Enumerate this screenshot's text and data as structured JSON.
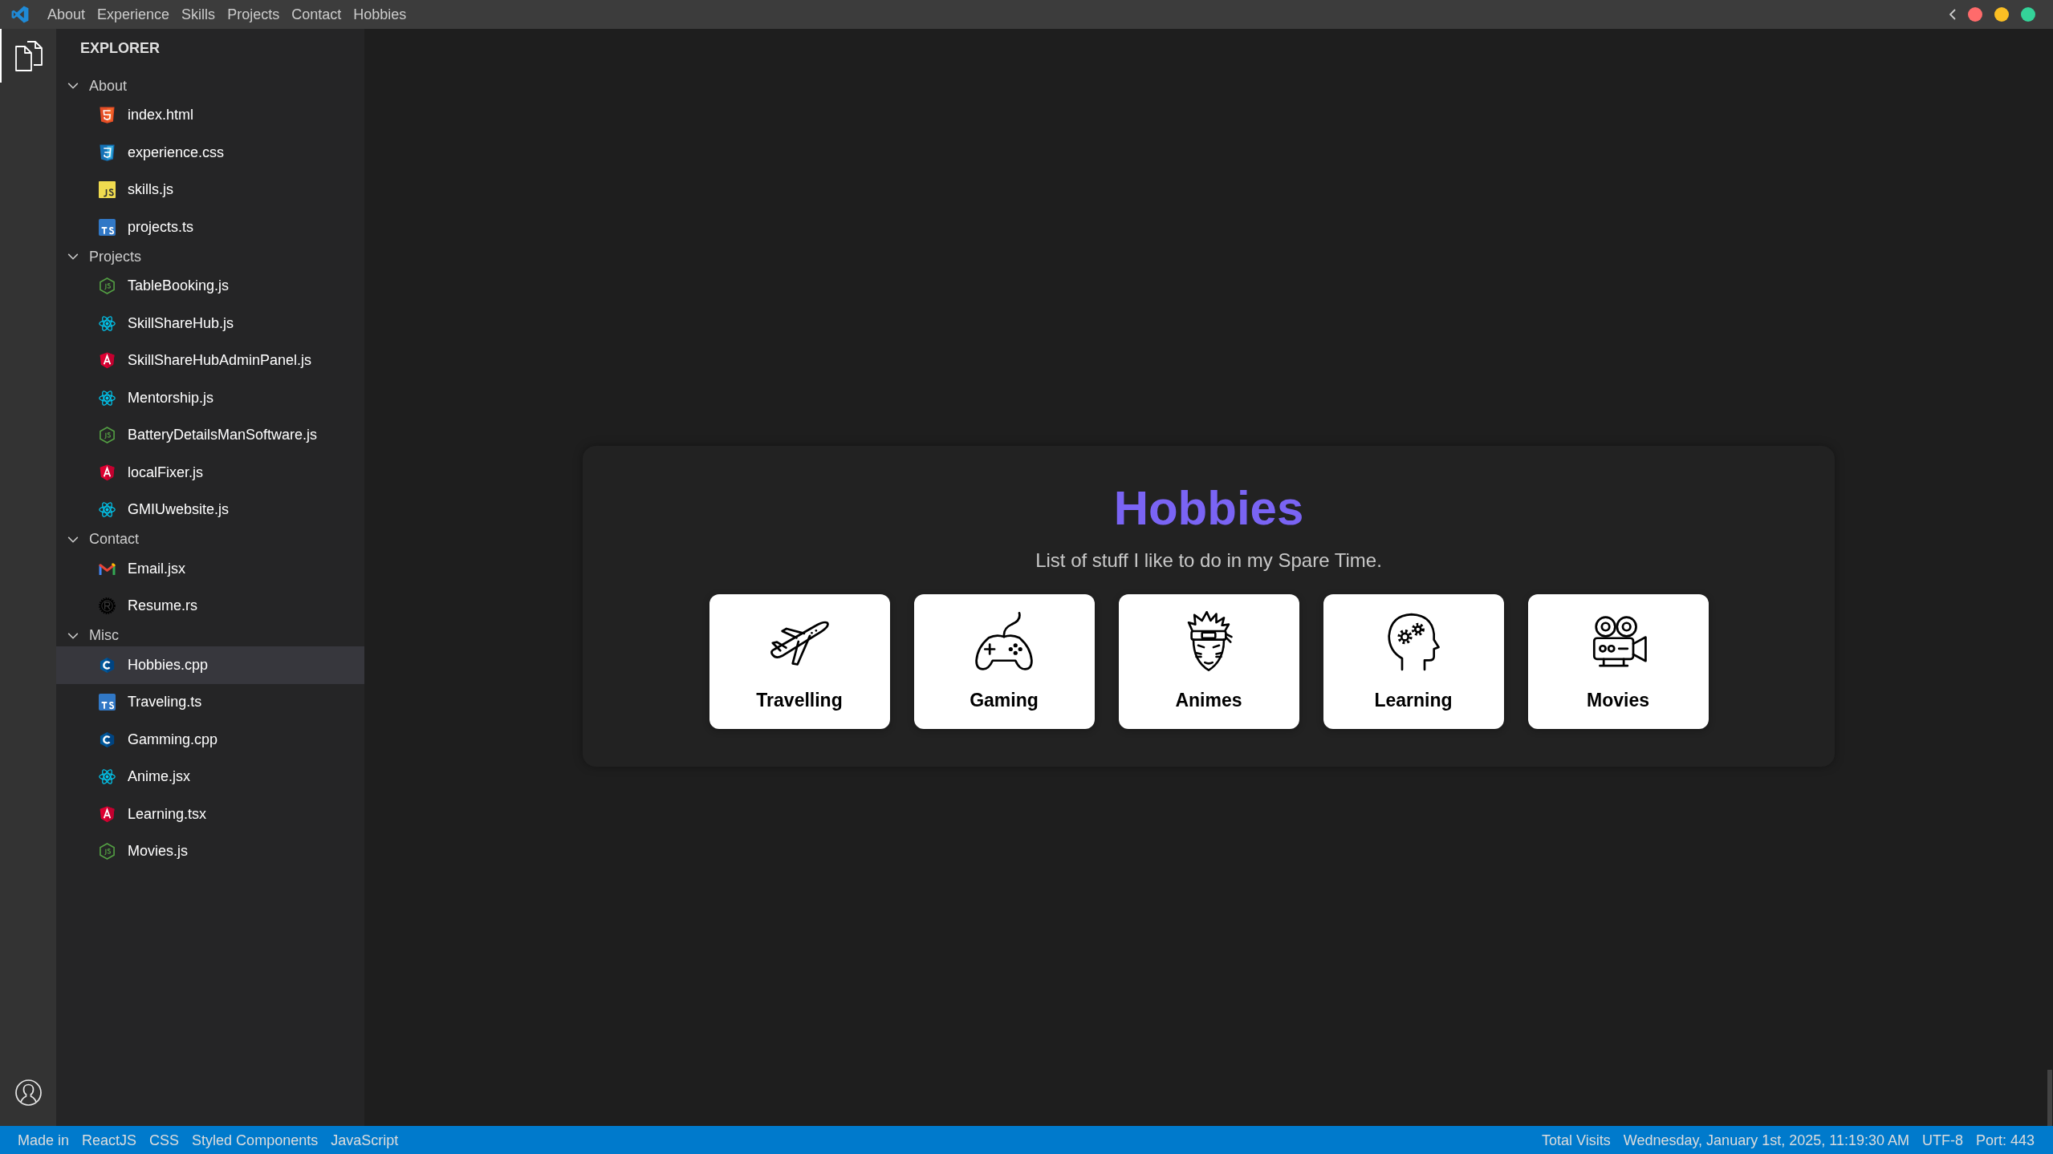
{
  "title_bar": {
    "menu": [
      "About",
      "Experience",
      "Skills",
      "Projects",
      "Contact",
      "Hobbies"
    ],
    "window_controls": [
      {
        "color": "#ff6b6b"
      },
      {
        "color": "#fbbf24"
      },
      {
        "color": "#34d399"
      }
    ]
  },
  "activity_bar": {
    "items": [
      {
        "selected": true
      }
    ]
  },
  "explorer": {
    "title": "EXPLORER",
    "folders": [
      {
        "label": "About",
        "expanded": true,
        "children": [
          {
            "label": "index.html",
            "kind": "html",
            "selected": false
          },
          {
            "label": "experience.css",
            "kind": "css",
            "selected": false
          },
          {
            "label": "skills.js",
            "kind": "js",
            "selected": false
          },
          {
            "label": "projects.ts",
            "kind": "ts",
            "selected": false
          }
        ]
      },
      {
        "label": "Projects",
        "expanded": true,
        "children": [
          {
            "label": "TableBooking.js",
            "kind": "node",
            "selected": false
          },
          {
            "label": "SkillShareHub.js",
            "kind": "react",
            "selected": false
          },
          {
            "label": "SkillShareHubAdminPanel.js",
            "kind": "angular",
            "selected": false
          },
          {
            "label": "Mentorship.js",
            "kind": "react",
            "selected": false
          },
          {
            "label": "BatteryDetailsManSoftware.js",
            "kind": "node",
            "selected": false
          },
          {
            "label": "localFixer.js",
            "kind": "angular",
            "selected": false
          },
          {
            "label": "GMIUwebsite.js",
            "kind": "react",
            "selected": false
          }
        ]
      },
      {
        "label": "Contact",
        "expanded": true,
        "children": [
          {
            "label": "Email.jsx",
            "kind": "mail",
            "selected": false
          },
          {
            "label": "Resume.rs",
            "kind": "rust",
            "selected": false
          }
        ]
      },
      {
        "label": "Misc",
        "expanded": true,
        "children": [
          {
            "label": "Hobbies.cpp",
            "kind": "cpp",
            "selected": true
          },
          {
            "label": "Traveling.ts",
            "kind": "ts",
            "selected": false
          },
          {
            "label": "Gamming.cpp",
            "kind": "cpp",
            "selected": false
          },
          {
            "label": "Anime.jsx",
            "kind": "react",
            "selected": false
          },
          {
            "label": "Learning.tsx",
            "kind": "angular",
            "selected": false
          },
          {
            "label": "Movies.js",
            "kind": "node",
            "selected": false
          }
        ]
      }
    ]
  },
  "hobbies": {
    "title": "Hobbies",
    "subtitle": "List of stuff I like to do in my Spare Time.",
    "cards": [
      {
        "label": "Travelling",
        "kind": "plane"
      },
      {
        "label": "Gaming",
        "kind": "controller"
      },
      {
        "label": "Animes",
        "kind": "anime"
      },
      {
        "label": "Learning",
        "kind": "brain"
      },
      {
        "label": "Movies",
        "kind": "camera"
      }
    ]
  },
  "status_bar": {
    "left": [
      "Made in",
      "ReactJS",
      "CSS",
      "Styled Components",
      "JavaScript"
    ],
    "right": [
      "Total Visits",
      "Wednesday, January 1st, 2025, 11:19:30 AM",
      "UTF-8",
      "Port: 443"
    ]
  }
}
